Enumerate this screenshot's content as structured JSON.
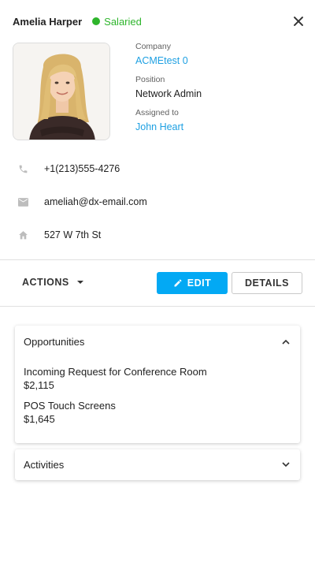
{
  "contact": {
    "name": "Amelia Harper",
    "status": "Salaried",
    "status_color": "#2eb52c"
  },
  "info": {
    "company_label": "Company",
    "company_value": "ACMEtest 0",
    "position_label": "Position",
    "position_value": "Network Admin",
    "assigned_label": "Assigned to",
    "assigned_value": "John Heart"
  },
  "contacts": {
    "phone": "+1(213)555-4276",
    "email": "ameliah@dx-email.com",
    "address": "527 W 7th St"
  },
  "toolbar": {
    "actions_label": "ACTIONS",
    "edit_label": "EDIT",
    "details_label": "DETAILS"
  },
  "opportunities": {
    "title": "Opportunities",
    "items": [
      {
        "name": "Incoming Request for Conference Room",
        "amount": "$2,115"
      },
      {
        "name": "POS Touch Screens",
        "amount": "$1,645"
      }
    ]
  },
  "activities": {
    "title": "Activities"
  },
  "colors": {
    "accent": "#03a9f4",
    "link": "#1ea0e2"
  }
}
